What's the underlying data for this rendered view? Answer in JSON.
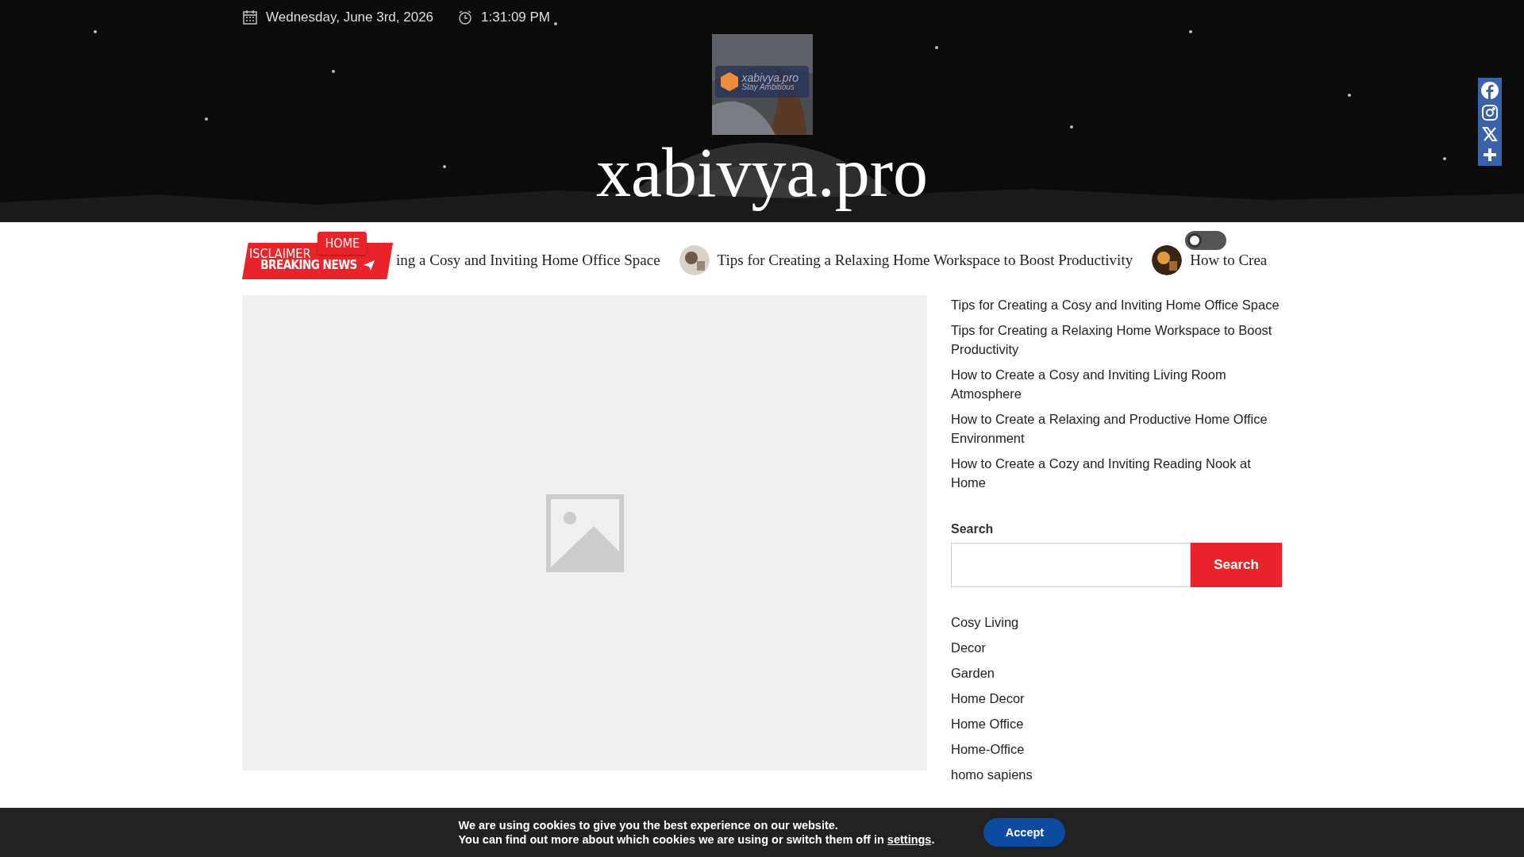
{
  "top_bar": {
    "date": "Wednesday, June 3rd, 2026",
    "time": "1:31:09 PM"
  },
  "logo": {
    "name": "xabivya.pro",
    "tagline": "Stay Ambitious"
  },
  "site_title": "xabivya.pro",
  "nav": {
    "items": [
      {
        "label": "ISCLAIMER",
        "selected": false
      },
      {
        "label": "HOME",
        "selected": true
      }
    ]
  },
  "breaking_news": {
    "label": "BREAKING NEWS",
    "items": [
      {
        "title": "ing a Cosy and Inviting Home Office Space",
        "thumbnail": false
      },
      {
        "title": "Tips for Creating a Relaxing Home Workspace to Boost Productivity",
        "thumbnail": true
      },
      {
        "title": "How to Crea",
        "thumbnail": true
      }
    ]
  },
  "dark_mode": {
    "on": false
  },
  "sidebar": {
    "recent_posts": [
      "Tips for Creating a Cosy and Inviting Home Office Space",
      "Tips for Creating a Relaxing Home Workspace to Boost Productivity",
      "How to Create a Cosy and Inviting Living Room Atmosphere",
      "How to Create a Relaxing and Productive Home Office Environment",
      "How to Create a Cozy and Inviting Reading Nook at Home"
    ],
    "search": {
      "label": "Search",
      "button": "Search"
    },
    "categories": [
      "Cosy Living",
      "Decor",
      "Garden",
      "Home Decor",
      "Home Office",
      "Home-Office",
      "homo sapiens"
    ]
  },
  "cookie_notice": {
    "line1": "We are using cookies to give you the best experience on our website.",
    "line2": "You can find out more about which cookies we are using or switch them off in",
    "link": "settings",
    "after_link": ".",
    "button": "Accept"
  }
}
